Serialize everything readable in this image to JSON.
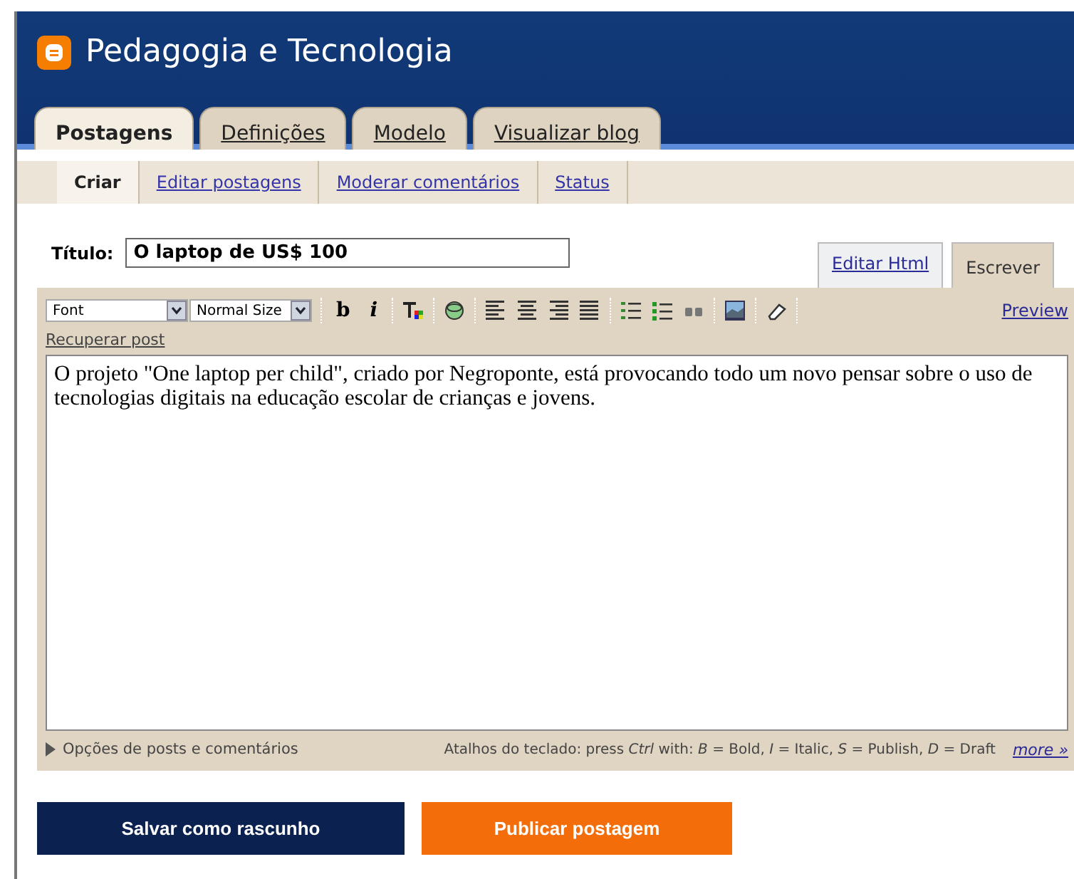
{
  "header": {
    "title": "Pedagogia e Tecnologia"
  },
  "tabs": [
    {
      "label": "Postagens",
      "selected": true
    },
    {
      "label": "Definições",
      "selected": false
    },
    {
      "label": "Modelo",
      "selected": false
    },
    {
      "label": "Visualizar blog",
      "selected": false
    }
  ],
  "subtabs": [
    {
      "label": "Criar",
      "selected": true
    },
    {
      "label": "Editar postagens",
      "selected": false
    },
    {
      "label": "Moderar comentários",
      "selected": false
    },
    {
      "label": "Status",
      "selected": false
    }
  ],
  "title_field": {
    "label": "Título:",
    "value": "O laptop de US$ 100"
  },
  "mode_tabs": [
    {
      "label": "Editar Html",
      "selected": false
    },
    {
      "label": "Escrever",
      "selected": true
    }
  ],
  "toolbar": {
    "font": "Font",
    "size": "Normal Size",
    "bold": "b",
    "italic": "i",
    "preview": "Preview"
  },
  "recover_link": "Recuperar post",
  "body": "O projeto \"One laptop per child\", criado por Negroponte, está provocando todo um novo pensar sobre o uso de tecnologias digitais na educação escolar de crianças e jovens.",
  "options": "Opções de posts e comentários",
  "shortcuts": "Atalhos do teclado: press *Ctrl* with: *B* = Bold,  *I* = Italic,  *S* = Publish,  *D* = Draft",
  "more_link": "more »",
  "buttons": [
    {
      "label": "Salvar como rascunho",
      "kind": "draft"
    },
    {
      "label": "Publicar postagem",
      "kind": "publish"
    }
  ]
}
